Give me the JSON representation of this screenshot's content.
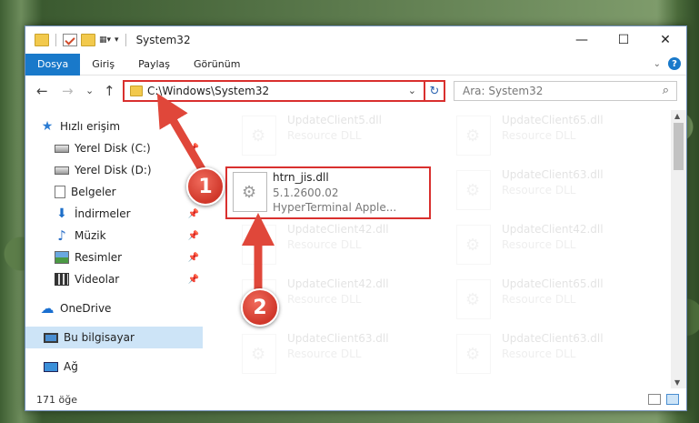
{
  "window": {
    "title": "System32",
    "controls": {
      "minimize": "—",
      "maximize": "☐",
      "close": "✕"
    }
  },
  "ribbon": {
    "tabs": [
      {
        "label": "Dosya",
        "active": true
      },
      {
        "label": "Giriş"
      },
      {
        "label": "Paylaş"
      },
      {
        "label": "Görünüm"
      }
    ],
    "expand_icon": "chevron-down-icon",
    "help": "?"
  },
  "nav": {
    "back": "←",
    "forward": "→",
    "recent": "⌄",
    "up": "↑",
    "address": "C:\\Windows\\System32",
    "search_placeholder": "Ara: System32"
  },
  "sidebar": {
    "items": [
      {
        "label": "Hızlı erişim",
        "icon": "star-icon"
      },
      {
        "label": "Yerel Disk (C:)",
        "icon": "disk-icon",
        "pinned": true
      },
      {
        "label": "Yerel Disk (D:)",
        "icon": "disk-icon"
      },
      {
        "label": "Belgeler",
        "icon": "document-icon",
        "pinned": true
      },
      {
        "label": "İndirmeler",
        "icon": "download-icon",
        "pinned": true
      },
      {
        "label": "Müzik",
        "icon": "music-icon",
        "pinned": true
      },
      {
        "label": "Resimler",
        "icon": "pictures-icon",
        "pinned": true
      },
      {
        "label": "Videolar",
        "icon": "videos-icon",
        "pinned": true
      },
      {
        "label": "OneDrive",
        "icon": "cloud-icon"
      },
      {
        "label": "Bu bilgisayar",
        "icon": "computer-icon",
        "selected": true
      },
      {
        "label": "Ağ",
        "icon": "network-icon"
      }
    ]
  },
  "files": [
    {
      "name": "UpdateClient5.dll",
      "desc": "Resource DLL",
      "faded": true
    },
    {
      "name": "UpdateClient65.dll",
      "desc": "Resource DLL",
      "faded": true
    },
    {
      "name": "htrn_jis.dll",
      "version": "5.1.2600.02",
      "desc": "HyperTerminal Apple...",
      "faded": false
    },
    {
      "name": "UpdateClient63.dll",
      "desc": "Resource DLL",
      "faded": true
    },
    {
      "name": "UpdateClient42.dll",
      "desc": "Resource DLL",
      "faded": true
    },
    {
      "name": "UpdateClient42.dll",
      "desc": "Resource DLL",
      "faded": true
    },
    {
      "name": "UpdateClient42.dll",
      "desc": "Resource DLL",
      "faded": true
    },
    {
      "name": "UpdateClient65.dll",
      "desc": "Resource DLL",
      "faded": true
    },
    {
      "name": "UpdateClient63.dll",
      "desc": "Resource DLL",
      "faded": true
    },
    {
      "name": "UpdateClient63.dll",
      "desc": "Resource DLL",
      "faded": true
    }
  ],
  "status": {
    "count": "171 öğe"
  },
  "callouts": [
    {
      "label": "1"
    },
    {
      "label": "2"
    }
  ],
  "colors": {
    "accent": "#1979ca",
    "highlight": "#d9302e",
    "callout": "#d0372a"
  }
}
